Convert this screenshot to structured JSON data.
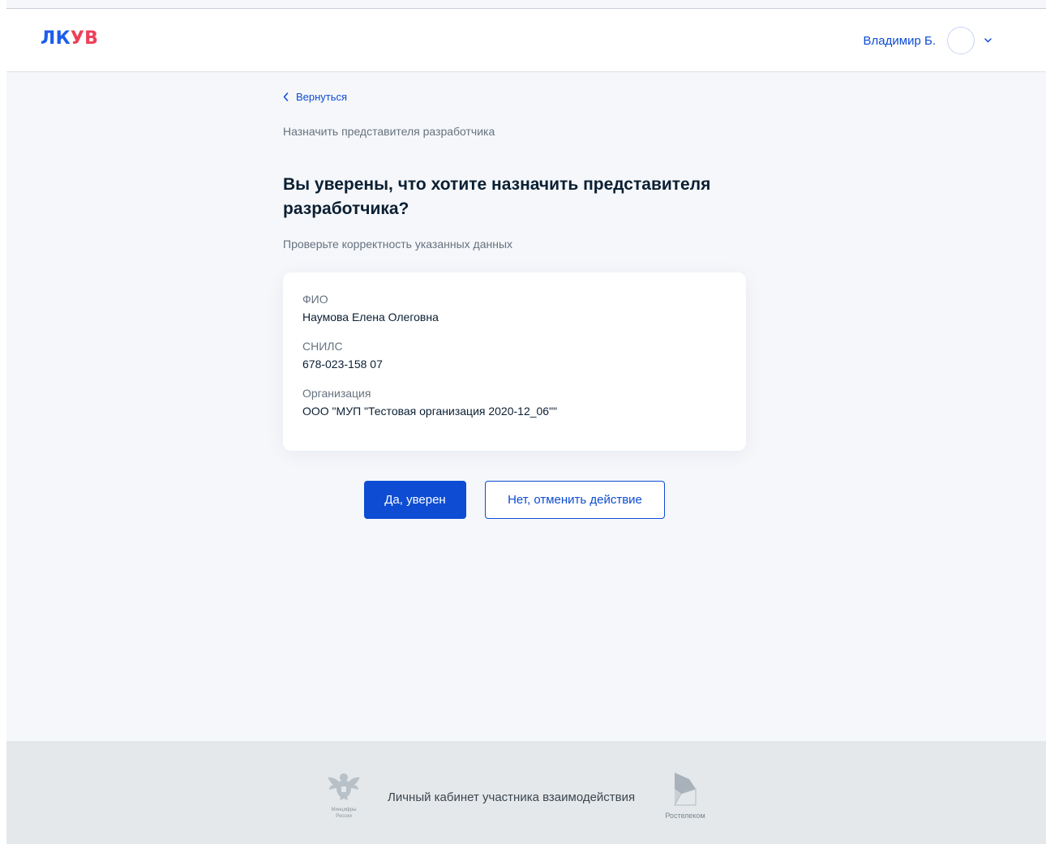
{
  "header": {
    "logo_part1": "ЛК",
    "logo_part2": "УВ",
    "user_name": "Владимир Б."
  },
  "main": {
    "back_label": "Вернуться",
    "subtitle": "Назначить представителя разработчика",
    "title": "Вы уверены, что хотите назначить представителя разработчика?",
    "hint": "Проверьте корректность указанных данных",
    "fields": [
      {
        "label": "ФИО",
        "value": "Наумова Елена Олеговна"
      },
      {
        "label": "СНИЛС",
        "value": "678-023-158 07"
      },
      {
        "label": "Организация",
        "value": "ООО \"МУП \"Тестовая организация 2020-12_06\"\""
      }
    ],
    "confirm_label": "Да, уверен",
    "cancel_label": "Нет, отменить действие"
  },
  "footer": {
    "emblem_caption_1": "Минцифры",
    "emblem_caption_2": "России",
    "title": "Личный кабинет участника взаимодействия",
    "rt_caption": "Ростелеком"
  },
  "colors": {
    "accent": "#0d4cd3",
    "logo_blue": "#1d5deb",
    "logo_red": "#ee3f58",
    "page_bg": "#f5f7fa",
    "footer_bg": "#e4e8ea",
    "text_primary": "#0b1f33",
    "text_secondary": "#66727f"
  },
  "icons": {
    "back": "chevron-left-icon",
    "user_menu": "chevron-down-icon",
    "emblem": "coat-of-arms-icon",
    "rt_logo": "rostelecom-logo-icon"
  }
}
